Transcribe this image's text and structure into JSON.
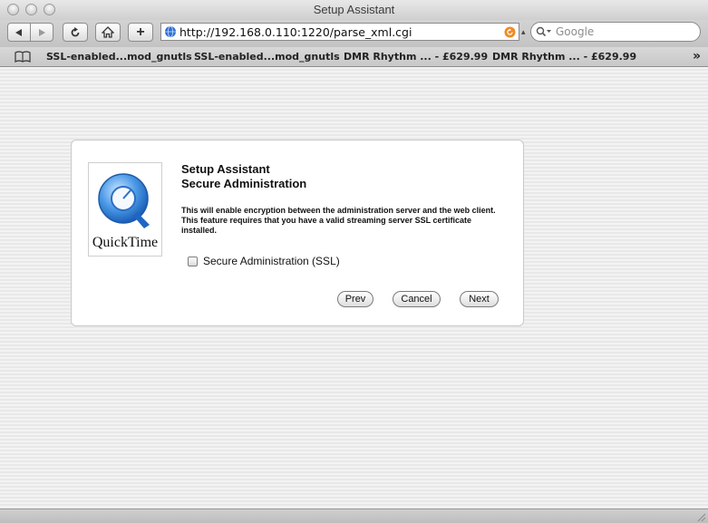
{
  "window": {
    "title": "Setup Assistant"
  },
  "toolbar": {
    "url": "http://192.168.0.110:1220/parse_xml.cgi",
    "search_placeholder": "Google",
    "add_label": "+"
  },
  "bookmarks": {
    "items": [
      "SSL-enabled...mod_gnutls",
      "SSL-enabled...mod_gnutls",
      "DMR Rhythm ... - £629.99",
      "DMR Rhythm ... - £629.99"
    ],
    "overflow": "»"
  },
  "dialog": {
    "logo_text": "QuickTime",
    "title": "Setup Assistant",
    "subtitle": "Secure Administration",
    "description": "This will enable encryption between the administration server and the web client. This feature requires that you have a valid streaming server SSL certificate installed.",
    "checkbox_label": "Secure Administration (SSL)",
    "checkbox_checked": false,
    "buttons": {
      "prev": "Prev",
      "cancel": "Cancel",
      "next": "Next"
    }
  },
  "icons": {
    "back": "back-arrow-icon",
    "forward": "forward-arrow-icon",
    "reload": "reload-icon",
    "home": "home-icon",
    "site": "globe-icon",
    "rss": "rss-icon",
    "search": "magnifier-icon",
    "bookmarks": "book-icon"
  },
  "colors": {
    "rss": "#f08a24",
    "globe": "#2f6fd1",
    "logo_blue": "#2a7fd6"
  }
}
